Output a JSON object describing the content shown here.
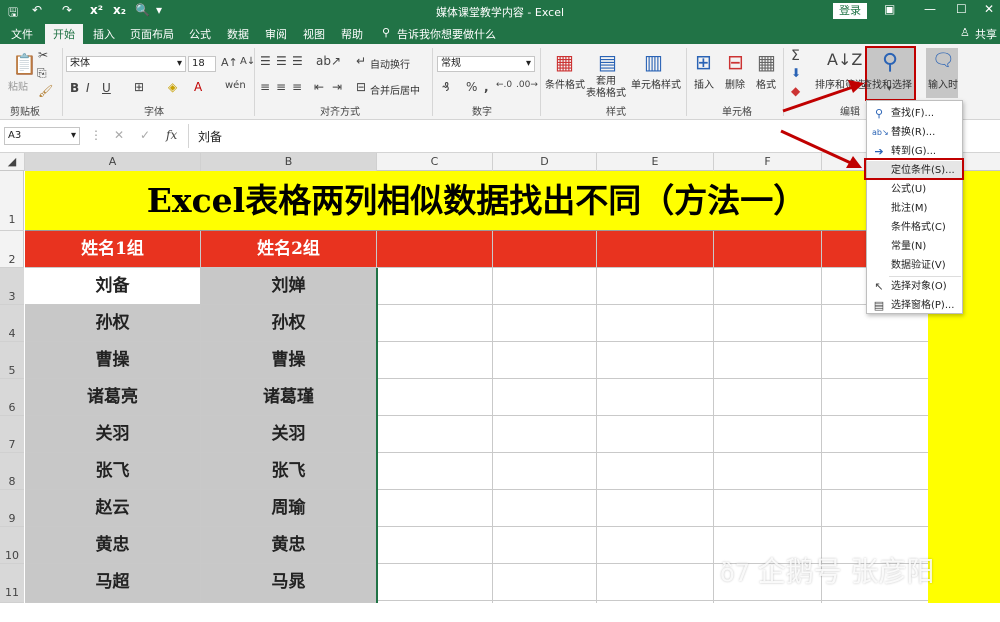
{
  "titlebar": {
    "title": "媒体课堂教学内容 - Excel",
    "login": "登录"
  },
  "tabs": [
    {
      "label": "文件"
    },
    {
      "label": "开始"
    },
    {
      "label": "插入"
    },
    {
      "label": "页面布局"
    },
    {
      "label": "公式"
    },
    {
      "label": "数据"
    },
    {
      "label": "审阅"
    },
    {
      "label": "视图"
    },
    {
      "label": "帮助"
    }
  ],
  "tell_me": "告诉我你想要做什么",
  "share": "共享",
  "ribbon": {
    "paste": "粘贴",
    "font_name": "宋体",
    "font_size": "18",
    "wrap_text": "自动换行",
    "merge_center": "合并后居中",
    "number_format": "常规",
    "conditional_format": "条件格式",
    "table_format": "套用\n表格格式",
    "cell_styles": "单元格样式",
    "insert": "插入",
    "delete": "删除",
    "format": "格式",
    "sort_filter": "排序和筛选",
    "find_select": "查找和选择",
    "input_time": "输入时",
    "groups": {
      "clipboard": "剪贴板",
      "font": "字体",
      "alignment": "对齐方式",
      "number": "数字",
      "styles": "样式",
      "cells": "单元格",
      "editing": "编辑"
    }
  },
  "formula_bar": {
    "name_box": "A3",
    "fx": "fx",
    "value": "刘备"
  },
  "columns": [
    "A",
    "B",
    "C",
    "D",
    "E",
    "F"
  ],
  "rows": [
    "1",
    "2",
    "3",
    "4",
    "5",
    "6",
    "7",
    "8",
    "9",
    "10",
    "11"
  ],
  "sheet": {
    "title": "Excel表格两列相似数据找出不同（方法一）",
    "header_a": "姓名1组",
    "header_b": "姓名2组",
    "col_a": [
      "刘备",
      "孙权",
      "曹操",
      "诸葛亮",
      "关羽",
      "张飞",
      "赵云",
      "黄忠",
      "马超"
    ],
    "col_b": [
      "刘婵",
      "孙权",
      "曹操",
      "诸葛瑾",
      "关羽",
      "张飞",
      "周瑜",
      "黄忠",
      "马晁"
    ]
  },
  "find_menu": [
    {
      "label": "查找(F)...",
      "icon": "search-icon"
    },
    {
      "label": "替换(R)...",
      "icon": "replace-icon"
    },
    {
      "label": "转到(G)...",
      "icon": "arrow-right-icon"
    },
    {
      "label": "定位条件(S)...",
      "icon": ""
    },
    {
      "label": "公式(U)",
      "icon": ""
    },
    {
      "label": "批注(M)",
      "icon": ""
    },
    {
      "label": "条件格式(C)",
      "icon": ""
    },
    {
      "label": "常量(N)",
      "icon": ""
    },
    {
      "label": "数据验证(V)",
      "icon": ""
    },
    {
      "label": "选择对象(O)",
      "icon": "cursor-icon"
    },
    {
      "label": "选择窗格(P)...",
      "icon": "pane-icon"
    }
  ],
  "watermark": "企鹅号 张彦阳",
  "colors": {
    "excel_green": "#217346",
    "title_yellow": "#ffff00",
    "header_red": "#e8331f",
    "gray_cell": "#c8c8c8",
    "highlight_red": "#c00000"
  }
}
